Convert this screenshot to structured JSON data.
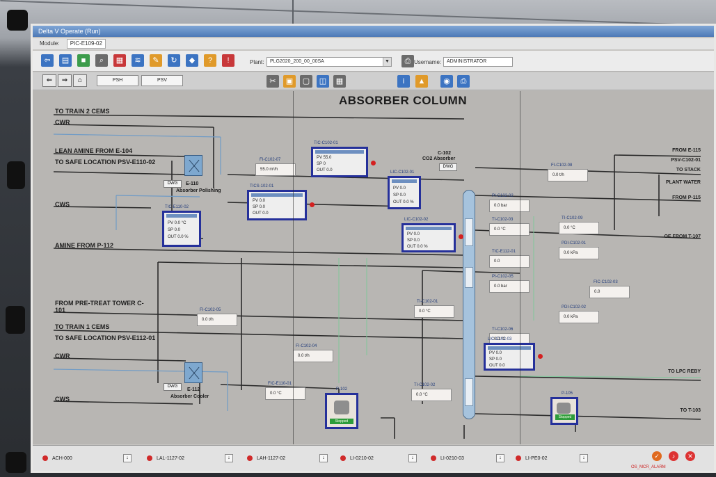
{
  "window": {
    "title": "Delta V Operate (Run)",
    "module_label": "Module:",
    "module_value": "PIC-E109-02"
  },
  "toolbar": {
    "plant_label": "Plant:",
    "plant_value": "PLG2020_200_00_00SA",
    "user_label": "Username:",
    "user_value": "ADMINISTRATOR"
  },
  "navbar": {
    "btn1": "PSH",
    "btn2": "PSV"
  },
  "graphic": {
    "title": "ABSORBER COLUMN",
    "streams_left": [
      "TO TRAIN 2 CEMS",
      "CWR",
      "LEAN AMINE FROM E-104",
      "TO SAFE LOCATION PSV-E110-02",
      "CWS",
      "AMINE FROM P-112",
      "FROM PRE-TREAT TOWER C-101",
      "TO TRAIN 1 CEMS",
      "TO SAFE LOCATION PSV-E112-01",
      "CWR",
      "CWS"
    ],
    "streams_right": [
      "FROM E-115",
      "PSV-C102-01",
      "TO STACK",
      "PLANT WATER",
      "FROM P-115",
      "OE FROM T-107",
      "TO LPC REBY",
      "TO T-103"
    ],
    "equipment": {
      "e110_tag": "E-110",
      "e110_name": "Absorber Polishing",
      "e112_tag": "E-112",
      "e112_name": "Absorber Cooler",
      "c102_tag": "C-102",
      "c102_name": "CO2 Absorber",
      "dwg": "DWG"
    },
    "tags": [
      {
        "label": "FI-C102-07",
        "value": "55.0 m³/h"
      },
      {
        "label": "FI-C102-08",
        "value": "0.0 t/h"
      },
      {
        "label": "PI-C102-02",
        "value": "0.0 bar"
      },
      {
        "label": "TI-C102-03",
        "value": "0.0 °C"
      },
      {
        "label": "PI-C102-05",
        "value": "0.0 bar"
      },
      {
        "label": "TI-C102-06",
        "value": "0.0 °C"
      },
      {
        "label": "PDI-C102-01",
        "value": "0.0 kPa"
      },
      {
        "label": "FI-C102-05",
        "value": "0.0 t/h"
      },
      {
        "label": "FI-C102-04",
        "value": "0.0 t/h"
      },
      {
        "label": "TI-C102-01",
        "value": "0.0 °C"
      },
      {
        "label": "PDI-C102-02",
        "value": "0.0 kPa"
      },
      {
        "label": "FIC-C102-03",
        "value": "0.0"
      },
      {
        "label": "TI-C102-02",
        "value": "0.0 °C"
      },
      {
        "label": "FIC-E110-01",
        "value": "0.0 °C"
      },
      {
        "label": "TIC-E112-01",
        "value": "0.0"
      },
      {
        "label": "TI-C102-09",
        "value": "0.0 °C"
      }
    ],
    "faceplates": [
      {
        "tag": "TIC-E110-02",
        "pv": "PV 0.0 °C",
        "sp": "SP 0.0",
        "out": "OUT 0.0 %"
      },
      {
        "tag": "TIC-C102-01",
        "pv": "PV 55.0",
        "sp": "SP 0",
        "out": "OUT 0.0"
      },
      {
        "tag": "LIC-C102-01",
        "pv": "PV 0.0",
        "sp": "SP 0.0",
        "out": "OUT 0.0 %"
      },
      {
        "tag": "TICS-102-01",
        "pv": "PV 0.0",
        "sp": "SP 0.0",
        "out": "OUT 0.0"
      },
      {
        "tag": "LIC-C102-02",
        "pv": "PV 0.0",
        "sp": "SP 0.0",
        "out": "OUT 0.0 %"
      },
      {
        "tag": "LIC-C102-03",
        "pv": "PV 0.0",
        "sp": "SP 0.0",
        "out": "OUT 0.0"
      }
    ],
    "pumps": [
      {
        "tag": "P-102",
        "state": "Stopped"
      },
      {
        "tag": "P-105",
        "state": "Stopped"
      }
    ]
  },
  "alarms": [
    {
      "text": "ACH-000"
    },
    {
      "text": "LAL-1127-02"
    },
    {
      "text": "LAH-1127-02"
    },
    {
      "text": "LI-0210-02"
    },
    {
      "text": "LI-0210-03"
    },
    {
      "text": "LI-PE0-02"
    }
  ],
  "status": {
    "bottom_right": "OS_MCR_ALARM"
  }
}
